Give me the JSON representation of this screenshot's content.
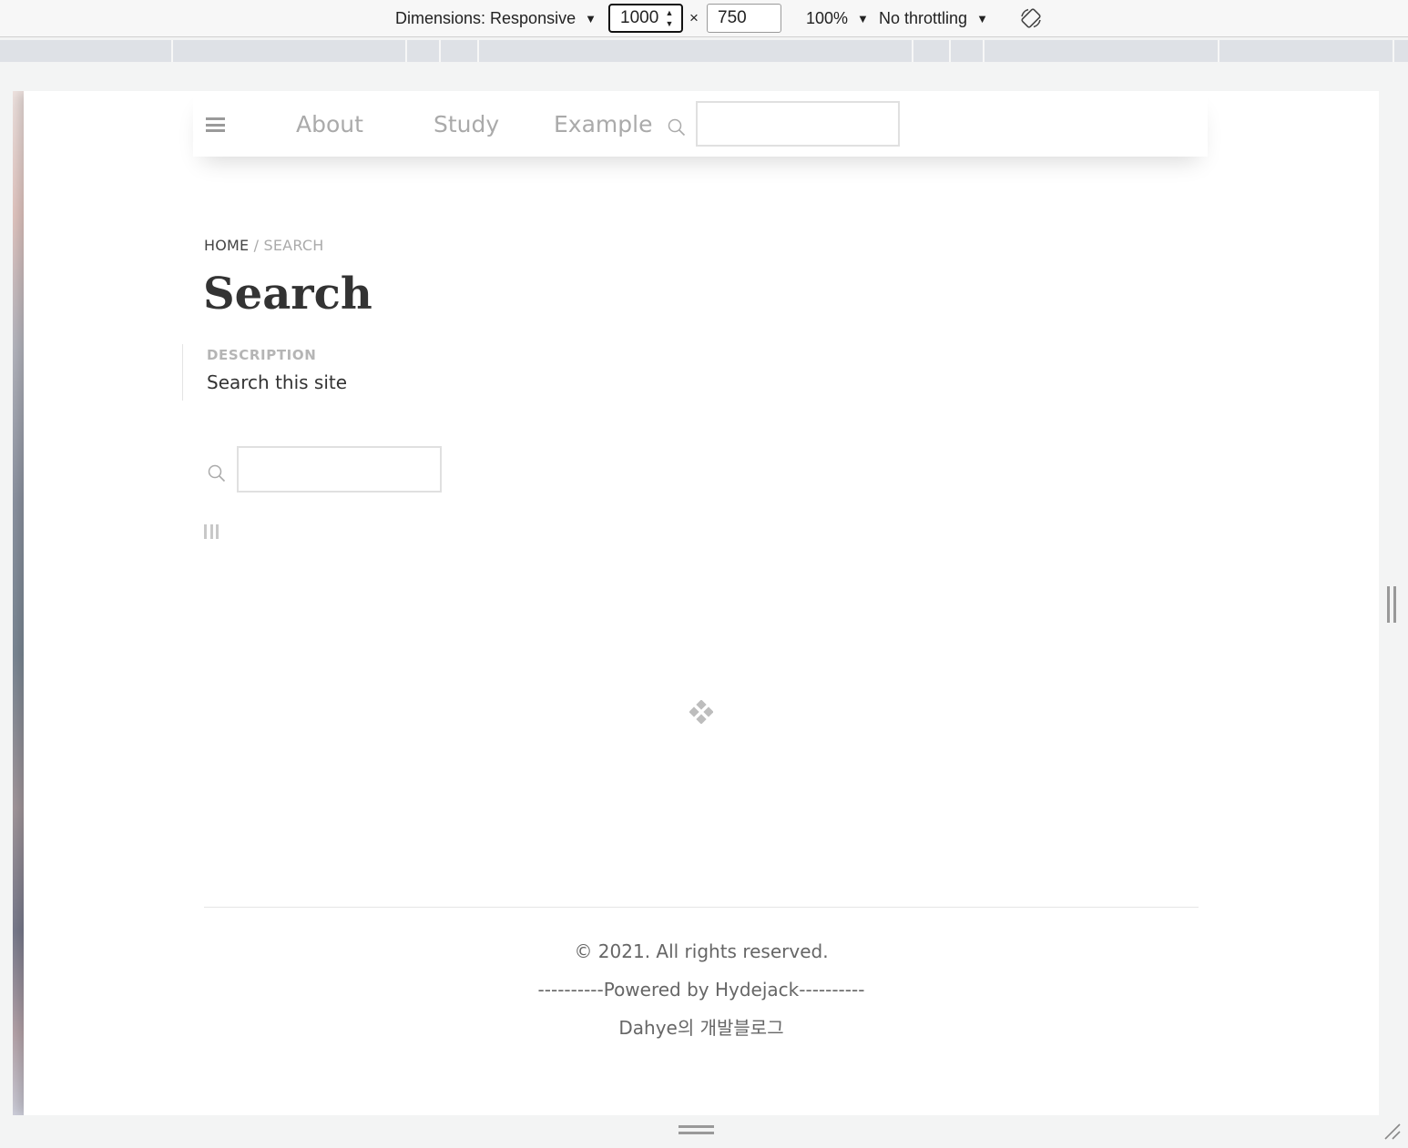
{
  "devtools": {
    "dimensions_label": "Dimensions: Responsive",
    "width_value": "1000",
    "times_sign": "×",
    "height_value": "750",
    "zoom_label": "100%",
    "throttling_label": "No throttling",
    "caret": "▼",
    "spin_up": "▲",
    "spin_down": "▼",
    "rotate_icon": "rotate-device-icon"
  },
  "page": {
    "nav": {
      "menu_icon": "hamburger-menu-icon",
      "links": [
        "About",
        "Study",
        "Example"
      ],
      "search_icon": "search-icon",
      "search_placeholder": ""
    },
    "breadcrumb": {
      "home": "HOME",
      "separator": " / ",
      "current": "SEARCH"
    },
    "title": "Search",
    "description": {
      "heading": "DESCRIPTION",
      "text": "Search this site"
    },
    "search": {
      "icon": "search-icon",
      "placeholder": ""
    },
    "results_icon": "results-columns-icon",
    "loading_icon": "loading-diamonds-icon",
    "footer": {
      "copyright": "© 2021. All rights reserved.",
      "powered_by": "----------Powered by Hydejack----------",
      "blog_name": "Dahye의 개발블로그"
    }
  },
  "colors": {
    "nav_link": "#aaaaaa",
    "title": "#333333",
    "footer_text": "#666666",
    "ruler": "#dee1e6"
  }
}
